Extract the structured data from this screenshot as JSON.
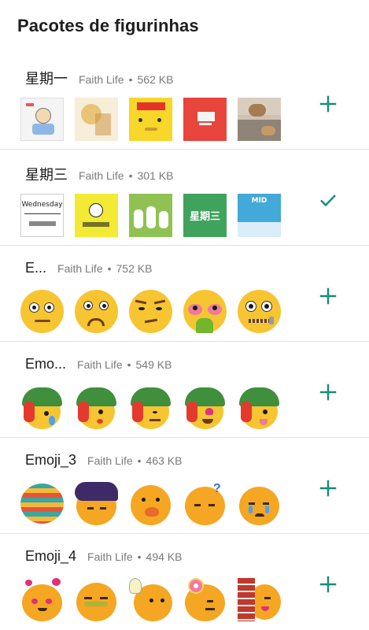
{
  "screen": {
    "title": "Pacotes de figurinhas"
  },
  "colors": {
    "accent": "#128C7E",
    "meta": "#7a7a7a",
    "divider": "#e2e2e2"
  },
  "packs": [
    {
      "name": "星期一",
      "author": "Faith Life",
      "separator": "•",
      "size": "562 KB",
      "action": "add-icon",
      "stickers": [
        "cartoon-figure",
        "autumn-card",
        "yellow-face-card",
        "red-text-card",
        "cat-photo"
      ]
    },
    {
      "name": "星期三",
      "author": "Faith Life",
      "separator": "•",
      "size": "301 KB",
      "action": "check-icon",
      "thumb_text": {
        "wednesday": "Wednesday",
        "day": "星期三",
        "mid": "MID"
      },
      "stickers": [
        "wednesday-card",
        "yellow-chick-card",
        "green-cartoon-card",
        "green-text-card",
        "sky-card"
      ]
    },
    {
      "name": "E...",
      "author": "Faith Life",
      "separator": "•",
      "size": "752 KB",
      "action": "add-icon",
      "stickers": [
        "worried-face",
        "frowning-face",
        "skeptical-face",
        "nauseated-face",
        "zipper-mouth-face"
      ]
    },
    {
      "name": "Emo...",
      "author": "Faith Life",
      "separator": "•",
      "size": "549 KB",
      "action": "add-icon",
      "stickers": [
        "helmet-crying",
        "helmet-kiss",
        "helmet-wink",
        "helmet-heart",
        "helmet-tongue"
      ]
    },
    {
      "name": "Emoji_3",
      "author": "Faith Life",
      "separator": "•",
      "size": "463 KB",
      "action": "add-icon",
      "stickers": [
        "striped-ball",
        "purple-hair-face",
        "duck-beak-face",
        "question-face",
        "crying-face"
      ]
    },
    {
      "name": "Emoji_4",
      "author": "Faith Life",
      "separator": "•",
      "size": "494 KB",
      "action": "add-icon",
      "stickers": [
        "hearts-face",
        "squint-face",
        "lightbulb-face",
        "donut-face",
        "brick-wall-face"
      ]
    }
  ]
}
